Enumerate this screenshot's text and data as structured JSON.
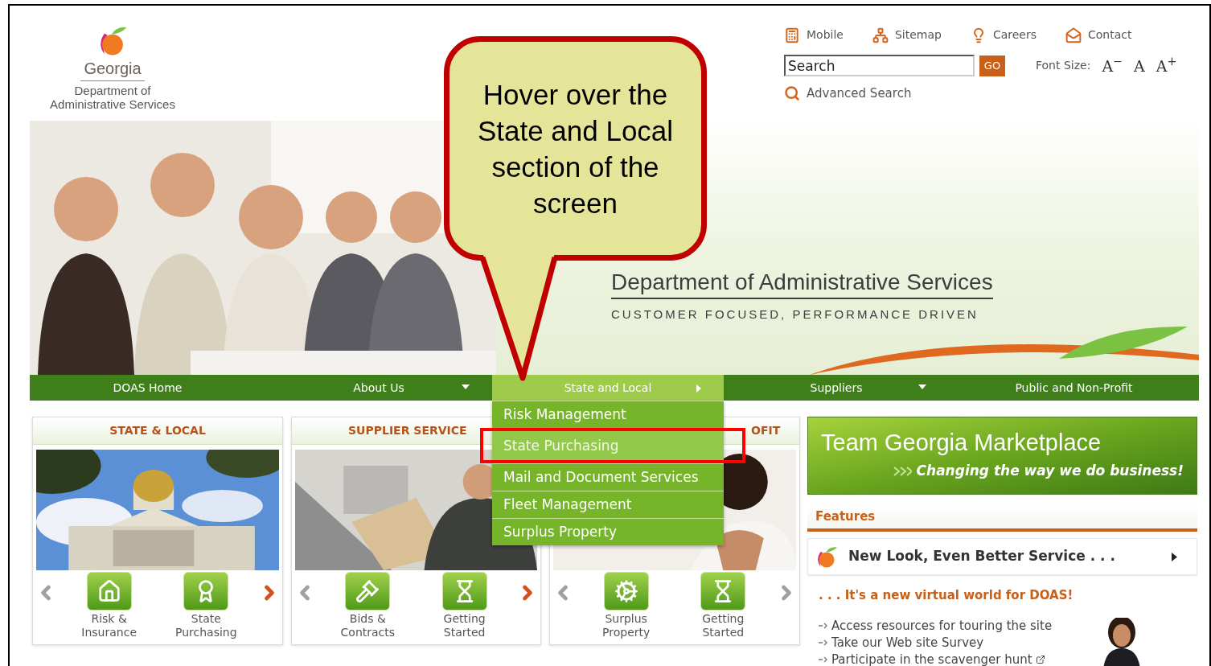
{
  "logo": {
    "name": "Georgia",
    "subtitle": "Department of Administrative Services"
  },
  "top_links": [
    {
      "label": "Mobile"
    },
    {
      "label": "Sitemap"
    },
    {
      "label": "Careers"
    },
    {
      "label": "Contact"
    }
  ],
  "search": {
    "placeholder": "Search",
    "button": "GO"
  },
  "font_size": {
    "label": "Font Size:",
    "options": [
      "A$^{−}$",
      "A",
      "A$^{+}$"
    ]
  },
  "advanced_search": "Advanced Search",
  "hero": {
    "title": "Department of Administrative Services",
    "tagline": "CUSTOMER FOCUSED, PERFORMANCE DRIVEN"
  },
  "nav": [
    {
      "label": "DOAS Home",
      "kind": "link",
      "selected": false
    },
    {
      "label": "About Us",
      "kind": "dropdown",
      "selected": false
    },
    {
      "label": "State and Local",
      "kind": "submenu",
      "selected": true
    },
    {
      "label": "Suppliers",
      "kind": "dropdown",
      "selected": false
    },
    {
      "label": "Public and Non-Profit",
      "kind": "link",
      "selected": false
    }
  ],
  "dropdown": [
    {
      "label": "Risk Management",
      "selected": false
    },
    {
      "label": "State Purchasing",
      "selected": true
    },
    {
      "label": "Mail and Document Services",
      "selected": false
    },
    {
      "label": "Fleet Management",
      "selected": false
    },
    {
      "label": "Surplus Property",
      "selected": false
    }
  ],
  "cards": [
    {
      "title": "STATE & LOCAL",
      "prev_enabled": false,
      "next_enabled": true,
      "tiles": [
        {
          "label": "Risk & Insurance"
        },
        {
          "label": "State Purchasing"
        }
      ]
    },
    {
      "title": "SUPPLIER SERVICE",
      "prev_enabled": false,
      "next_enabled": true,
      "tiles": [
        {
          "label": "Bids & Contracts"
        },
        {
          "label": "Getting Started"
        }
      ]
    },
    {
      "title": "OFIT",
      "prev_enabled": false,
      "next_enabled": false,
      "tiles": [
        {
          "label": "Surplus Property"
        },
        {
          "label": "Getting Started"
        }
      ]
    }
  ],
  "marketplace": {
    "title": "Team Georgia Marketplace",
    "tagline": "Changing the way we do business!"
  },
  "features": {
    "title": "Features",
    "item": "New Look, Even Better Service . . .",
    "tagline": ". . . It's a new virtual world for DOAS!",
    "links": [
      "Access resources for touring the site",
      "Take our Web site Survey",
      "Participate in the scavenger hunt"
    ]
  },
  "callout": {
    "text": "Hover over the State and Local section of the screen"
  }
}
